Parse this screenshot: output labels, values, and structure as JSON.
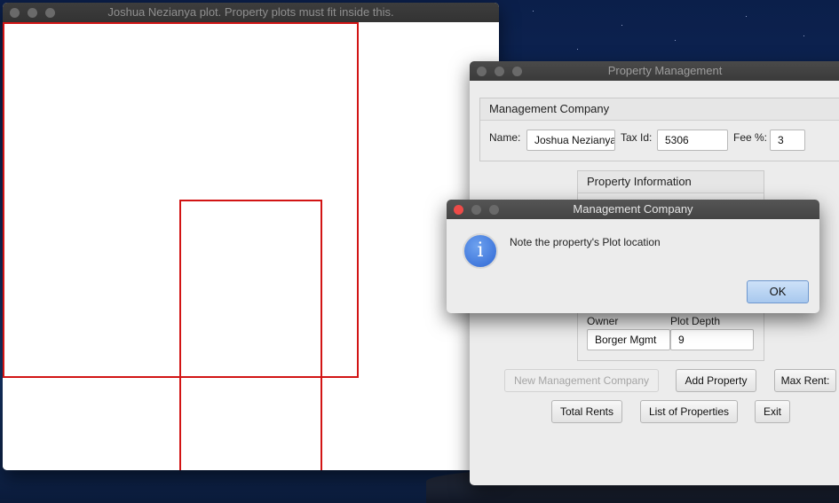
{
  "plot_window": {
    "title": "Joshua Nezianya plot. Property plots must fit inside this."
  },
  "pm_window": {
    "title": "Property Management",
    "company_panel": {
      "heading": "Management Company",
      "name_label": "Name:",
      "name_value": "Joshua Nezianya",
      "taxid_label": "Tax Id:",
      "taxid_value": "5306",
      "fee_label": "Fee %:",
      "fee_value": "3"
    },
    "property_panel": {
      "heading": "Property Information",
      "owner_label": "Owner",
      "owner_value": "Borger Mgmt",
      "depth_label": "Plot Depth",
      "depth_value": "9"
    },
    "buttons": {
      "new_company": "New Management Company",
      "add_property": "Add Property",
      "max_rent": "Max Rent:",
      "total_rents": "Total Rents",
      "list_properties": "List of Properties",
      "exit": "Exit"
    }
  },
  "dialog": {
    "title": "Management Company",
    "icon": "info-icon",
    "message": "Note the property's Plot location",
    "ok_label": "OK"
  },
  "colors": {
    "plot_outline": "#d21414",
    "desktop": "#102a5e"
  }
}
